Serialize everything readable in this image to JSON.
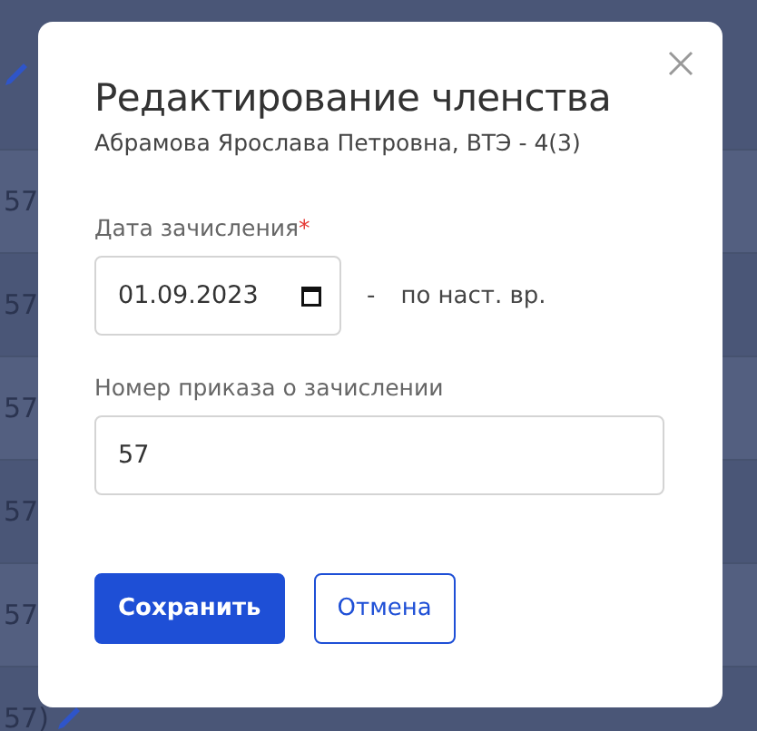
{
  "background_rows": [
    {
      "kind": "edit"
    },
    {
      "kind": "text",
      "text": "57"
    },
    {
      "kind": "text",
      "text": "57"
    },
    {
      "kind": "text",
      "text": "57"
    },
    {
      "kind": "text",
      "text": "57"
    },
    {
      "kind": "text",
      "text": "57"
    },
    {
      "kind": "text_edit",
      "text": "57)"
    }
  ],
  "dialog": {
    "title": "Редактирование членства",
    "subtitle": "Абрамова Ярослава Петровна, ВТЭ - 4(3)",
    "date_field": {
      "label": "Дата зачисления",
      "required_mark": "*",
      "value": "01.09.2023",
      "until": "по наст. вр.",
      "separator": "-"
    },
    "order_field": {
      "label": "Номер приказа о зачислении",
      "value": "57"
    },
    "buttons": [
      {
        "kind": "primary",
        "label": "Сохранить"
      },
      {
        "kind": "secondary",
        "label": "Отмена"
      }
    ]
  }
}
